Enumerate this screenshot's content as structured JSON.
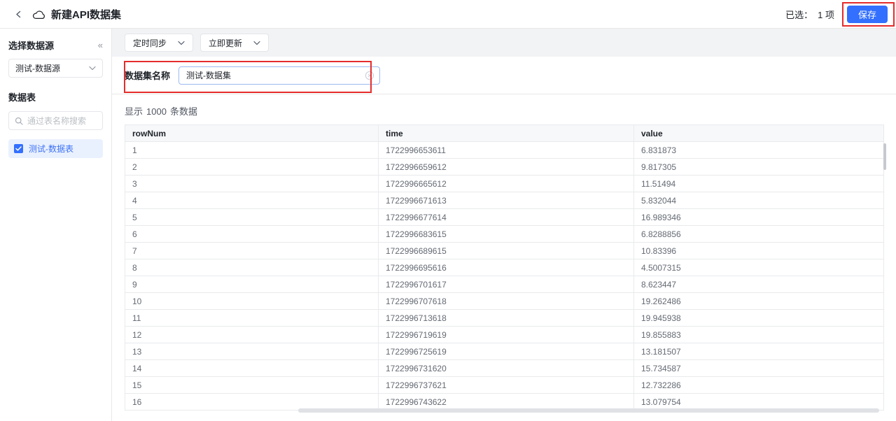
{
  "header": {
    "title": "新建API数据集",
    "selected_label": "已选：",
    "selected_count": "1 项",
    "save_label": "保存"
  },
  "sidebar": {
    "datasource_title": "选择数据源",
    "collapse_icon": "«",
    "datasource_value": "测试-数据源",
    "tables_title": "数据表",
    "search_placeholder": "通过表名称搜索",
    "table_item_label": "测试-数据表"
  },
  "toolbar": {
    "sync_dropdown": "定时同步",
    "update_dropdown": "立即更新"
  },
  "dataset_form": {
    "name_label": "数据集名称",
    "name_value": "测试-数据集"
  },
  "preview": {
    "summary_prefix": "显示",
    "summary_count": "1000",
    "summary_suffix": "条数据"
  },
  "table": {
    "columns": [
      "rowNum",
      "time",
      "value"
    ],
    "rows": [
      [
        "1",
        "1722996653611",
        "6.831873"
      ],
      [
        "2",
        "1722996659612",
        "9.817305"
      ],
      [
        "3",
        "1722996665612",
        "11.51494"
      ],
      [
        "4",
        "1722996671613",
        "5.832044"
      ],
      [
        "5",
        "1722996677614",
        "16.989346"
      ],
      [
        "6",
        "1722996683615",
        "6.8288856"
      ],
      [
        "7",
        "1722996689615",
        "10.83396"
      ],
      [
        "8",
        "1722996695616",
        "4.5007315"
      ],
      [
        "9",
        "1722996701617",
        "8.623447"
      ],
      [
        "10",
        "1722996707618",
        "19.262486"
      ],
      [
        "11",
        "1722996713618",
        "19.945938"
      ],
      [
        "12",
        "1722996719619",
        "19.855883"
      ],
      [
        "13",
        "1722996725619",
        "13.181507"
      ],
      [
        "14",
        "1722996731620",
        "15.734587"
      ],
      [
        "15",
        "1722996737621",
        "12.732286"
      ],
      [
        "16",
        "1722996743622",
        "13.079754"
      ]
    ]
  },
  "colors": {
    "primary": "#3370FF",
    "annotation_red": "#E62C2C",
    "selected_item_bg": "#EAF1FE",
    "toolbar_strip_bg": "#F2F3F5",
    "table_header_bg": "#F7F8FA"
  }
}
